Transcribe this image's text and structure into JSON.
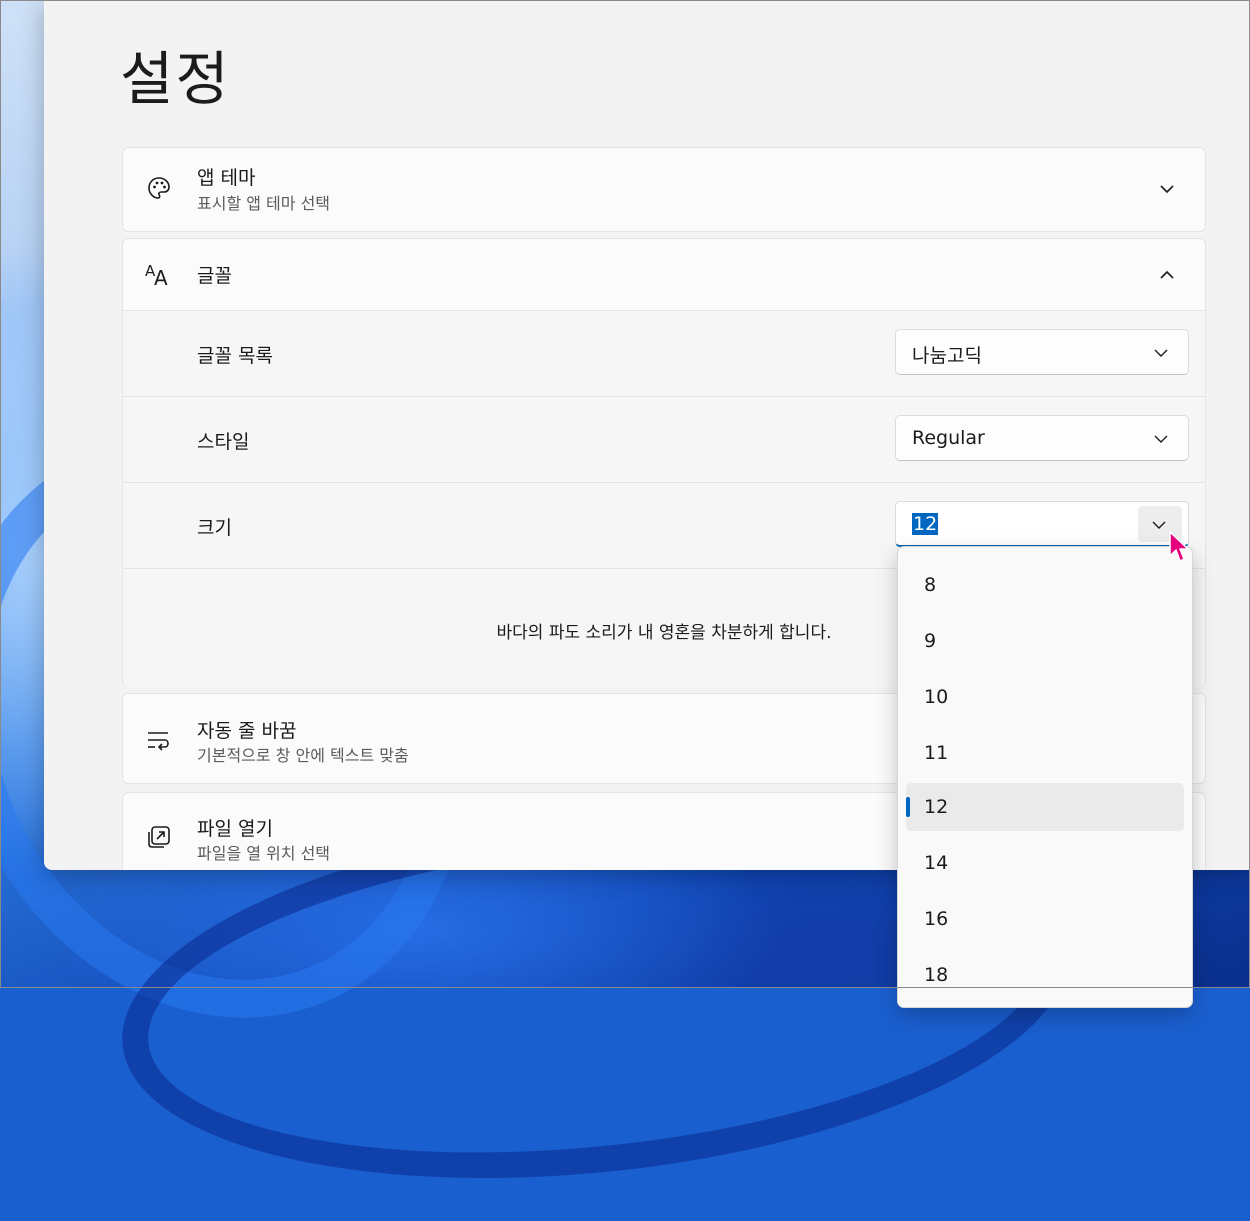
{
  "page_title": "설정",
  "sections": {
    "app_theme": {
      "title": "앱 테마",
      "subtitle": "표시할 앱 테마 선택"
    },
    "font": {
      "title": "글꼴",
      "family": {
        "label": "글꼴 목록",
        "value": "나눔고딕"
      },
      "style": {
        "label": "스타일",
        "value": "Regular"
      },
      "size": {
        "label": "크기",
        "value": "12"
      },
      "preview_text": "바다의 파도 소리가 내 영혼을 차분하게 합니다."
    },
    "word_wrap": {
      "title": "자동 줄 바꿈",
      "subtitle": "기본적으로 창 안에 텍스트 맞춤"
    },
    "open_file": {
      "title": "파일 열기",
      "subtitle": "파일을 열 위치 선택"
    }
  },
  "size_dropdown": {
    "options": [
      "8",
      "9",
      "10",
      "11",
      "12",
      "14",
      "16",
      "18"
    ],
    "selected": "12"
  },
  "colors": {
    "accent": "#0067c0",
    "cursor": "#e4007c"
  }
}
